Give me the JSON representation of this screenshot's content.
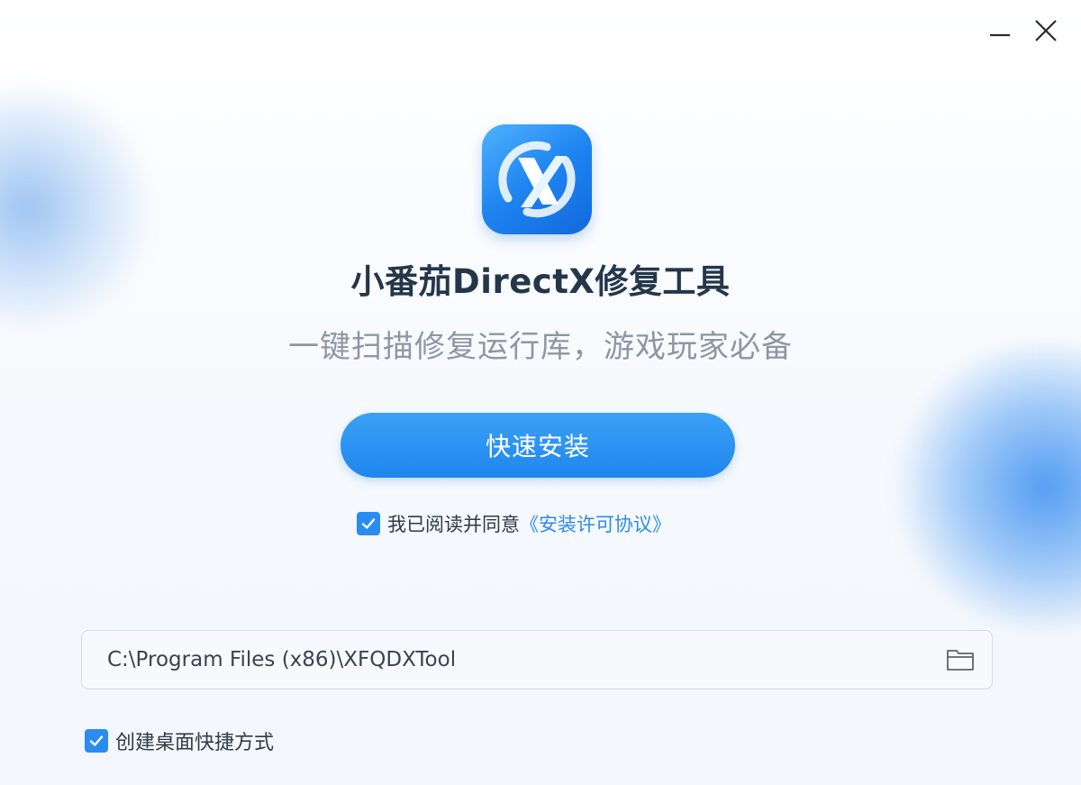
{
  "app": {
    "title": "小番茄DirectX修复工具",
    "subtitle": "一键扫描修复运行库，游戏玩家必备"
  },
  "icons": {
    "logo": "directx-x-logo-icon",
    "minimize": "minimize-icon",
    "close": "close-icon",
    "folder": "folder-icon",
    "check": "checkmark-icon"
  },
  "install": {
    "button_label": "快速安装"
  },
  "agreement": {
    "checked": true,
    "text": "我已阅读并同意",
    "link_text": "《安装许可协议》"
  },
  "install_path": {
    "value": "C:\\Program Files (x86)\\XFQDXTool"
  },
  "shortcut": {
    "checked": true,
    "label": "创建桌面快捷方式"
  },
  "colors": {
    "accent": "#2a8cf0",
    "title": "#24364a",
    "subtitle": "#8d97a3"
  }
}
